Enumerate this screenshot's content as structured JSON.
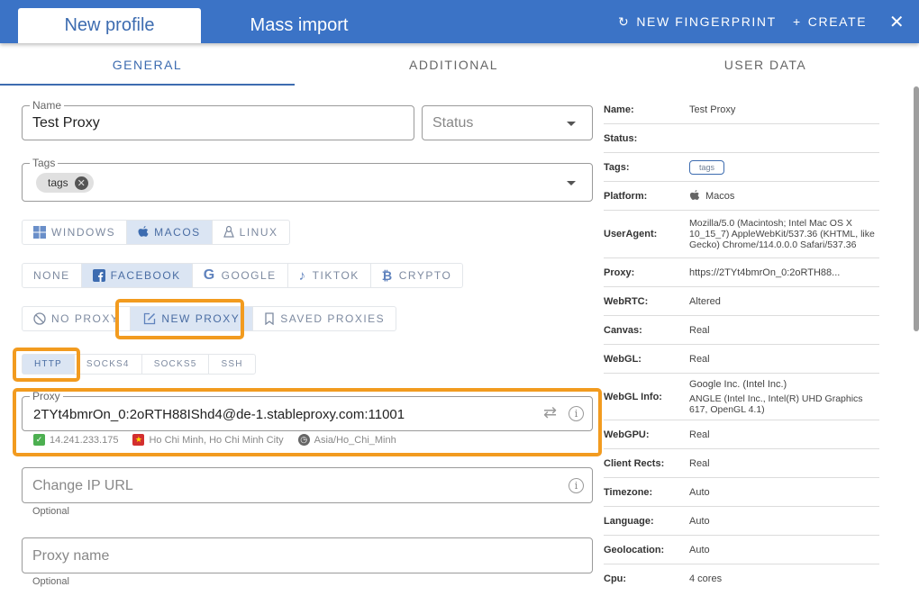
{
  "header": {
    "tabs": [
      {
        "label": "New profile",
        "active": true
      },
      {
        "label": "Mass import",
        "active": false
      }
    ],
    "actions": {
      "new_fingerprint": "NEW FINGERPRINT",
      "create": "CREATE"
    },
    "icons": {
      "refresh": "↻",
      "plus": "+",
      "close": "✕"
    }
  },
  "subtabs": [
    {
      "label": "GENERAL",
      "active": true
    },
    {
      "label": "ADDITIONAL",
      "active": false
    },
    {
      "label": "USER DATA",
      "active": false
    }
  ],
  "form": {
    "name": {
      "label": "Name",
      "value": "Test Proxy"
    },
    "status": {
      "placeholder": "Status",
      "value": ""
    },
    "tags": {
      "label": "Tags",
      "chips": [
        "tags"
      ]
    },
    "os": {
      "options": [
        "WINDOWS",
        "MACOS",
        "LINUX"
      ],
      "selected": "MACOS"
    },
    "template": {
      "options": [
        "NONE",
        "FACEBOOK",
        "GOOGLE",
        "TIKTOK",
        "CRYPTO"
      ],
      "selected": "FACEBOOK"
    },
    "proxy_mode": {
      "options": [
        "NO PROXY",
        "NEW PROXY",
        "SAVED PROXIES"
      ],
      "selected": "NEW PROXY"
    },
    "proxy_type": {
      "options": [
        "HTTP",
        "SOCKS4",
        "SOCKS5",
        "SSH"
      ],
      "selected": "HTTP"
    },
    "proxy": {
      "label": "Proxy",
      "value": "2TYt4bmrOn_0:2oRTH88IShd4@de-1.stableproxy.com:11001",
      "ip": "14.241.233.175",
      "location": "Ho Chi Minh, Ho Chi Minh City",
      "timezone": "Asia/Ho_Chi_Minh"
    },
    "change_ip_url": {
      "placeholder": "Change IP URL",
      "helper": "Optional",
      "value": ""
    },
    "proxy_name": {
      "placeholder": "Proxy name",
      "helper": "Optional",
      "value": ""
    }
  },
  "summary": {
    "rows": [
      {
        "key": "Name:",
        "value": "Test Proxy"
      },
      {
        "key": "Status:",
        "value": ""
      },
      {
        "key": "Tags:",
        "value": "tags"
      },
      {
        "key": "Platform:",
        "value": "Macos"
      },
      {
        "key": "UserAgent:",
        "value": "Mozilla/5.0 (Macintosh; Intel Mac OS X 10_15_7) AppleWebKit/537.36 (KHTML, like Gecko) Chrome/114.0.0.0 Safari/537.36"
      },
      {
        "key": "Proxy:",
        "value": "https://2TYt4bmrOn_0:2oRTH88..."
      },
      {
        "key": "WebRTC:",
        "value": "Altered"
      },
      {
        "key": "Canvas:",
        "value": "Real"
      },
      {
        "key": "WebGL:",
        "value": "Real"
      },
      {
        "key": "WebGL Info:",
        "value": "Google Inc. (Intel Inc.)",
        "value2": "ANGLE (Intel Inc., Intel(R) UHD Graphics 617, OpenGL 4.1)"
      },
      {
        "key": "WebGPU:",
        "value": "Real"
      },
      {
        "key": "Client Rects:",
        "value": "Real"
      },
      {
        "key": "Timezone:",
        "value": "Auto"
      },
      {
        "key": "Language:",
        "value": "Auto"
      },
      {
        "key": "Geolocation:",
        "value": "Auto"
      },
      {
        "key": "Cpu:",
        "value": "4 cores"
      }
    ]
  },
  "colors": {
    "brand": "#3b73c6",
    "highlight": "#f29b1f",
    "selected_bg": "#dbe5f3"
  }
}
